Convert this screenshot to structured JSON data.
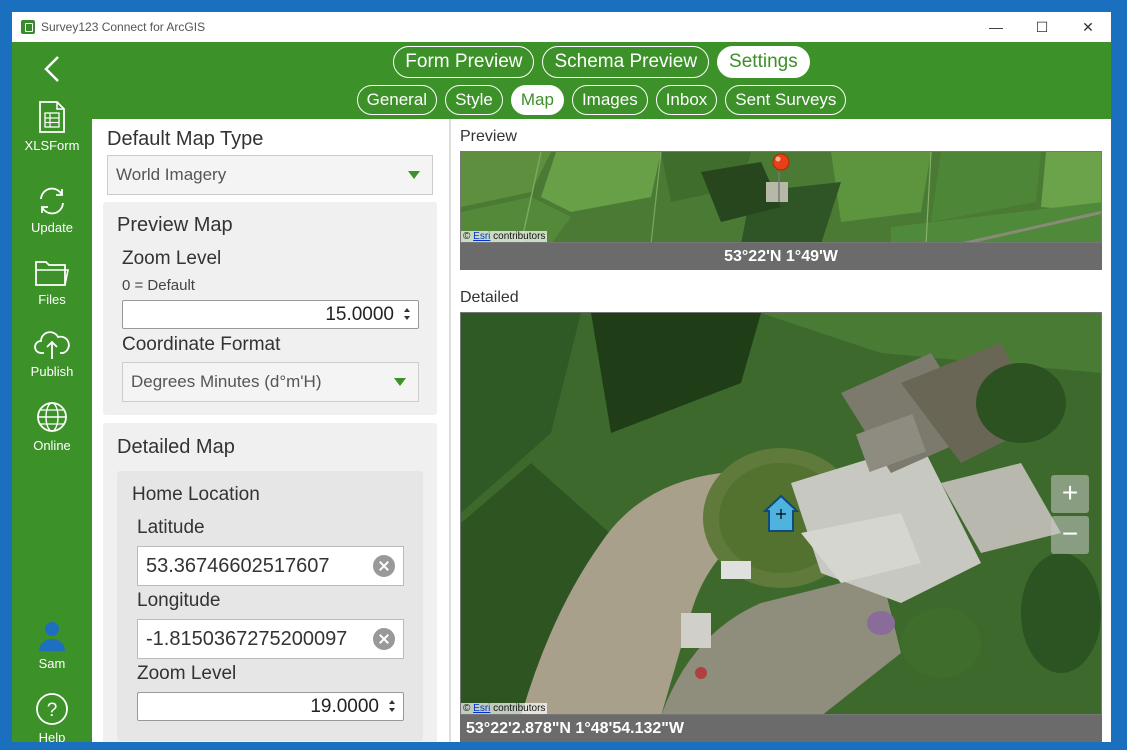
{
  "window": {
    "title": "Survey123 Connect for ArcGIS",
    "controls": {
      "minimize": "—",
      "maximize": "☐",
      "close": "✕"
    }
  },
  "sidebar": {
    "items": [
      {
        "label": "XLSForm",
        "icon": "spreadsheet-icon"
      },
      {
        "label": "Update",
        "icon": "refresh-icon"
      },
      {
        "label": "Files",
        "icon": "folder-icon"
      },
      {
        "label": "Publish",
        "icon": "cloud-upload-icon"
      },
      {
        "label": "Online",
        "icon": "globe-icon"
      }
    ],
    "user": {
      "label": "Sam",
      "icon": "user-icon"
    },
    "help": {
      "label": "Help",
      "icon": "help-icon",
      "glyph": "?"
    }
  },
  "header": {
    "tabs": [
      "Form Preview",
      "Schema Preview",
      "Settings"
    ],
    "active_tab": "Settings",
    "subtabs": [
      "General",
      "Style",
      "Map",
      "Images",
      "Inbox",
      "Sent Surveys"
    ],
    "active_subtab": "Map"
  },
  "settings": {
    "default_map_type": {
      "label": "Default Map Type",
      "value": "World Imagery"
    },
    "preview_map": {
      "title": "Preview Map",
      "zoom_label": "Zoom Level",
      "zoom_hint": "0 = Default",
      "zoom_value": "15.0000",
      "coord_format_label": "Coordinate Format",
      "coord_format_value": "Degrees Minutes (d°m'H)"
    },
    "detailed_map": {
      "title": "Detailed Map",
      "home_location": {
        "title": "Home Location",
        "latitude_label": "Latitude",
        "latitude_value": "53.36746602517607",
        "longitude_label": "Longitude",
        "longitude_value": "-1.8150367275200097",
        "zoom_label": "Zoom Level",
        "zoom_value": "19.0000"
      }
    }
  },
  "preview": {
    "label": "Preview",
    "coords": "53°22'N 1°49'W",
    "attribution_prefix": "©",
    "attribution_link": "Esri",
    "attribution_suffix": "contributors"
  },
  "detailed": {
    "label": "Detailed",
    "coords": "53°22'2.878\"N 1°48'54.132\"W",
    "zoom_in": "+",
    "zoom_out": "−"
  },
  "colors": {
    "accent_green": "#3c9128",
    "desktop_blue": "#1a6fbf",
    "coord_bar": "#6b6b6b"
  }
}
